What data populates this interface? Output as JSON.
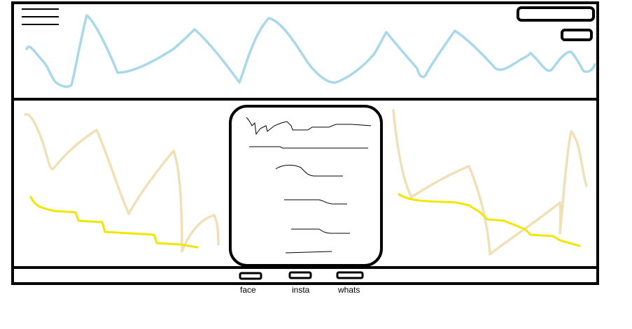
{
  "colors": {
    "outline": "#000000",
    "header_squiggle": "#a8d8ea",
    "beige_squiggle": "#efe0b8",
    "yellow_squiggle": "#f2e600",
    "background": "#ffffff"
  },
  "icons": {
    "menu": "hamburger-menu-icon"
  },
  "footer": {
    "links": [
      {
        "label": "face"
      },
      {
        "label": "insta"
      },
      {
        "label": "whats"
      }
    ]
  }
}
